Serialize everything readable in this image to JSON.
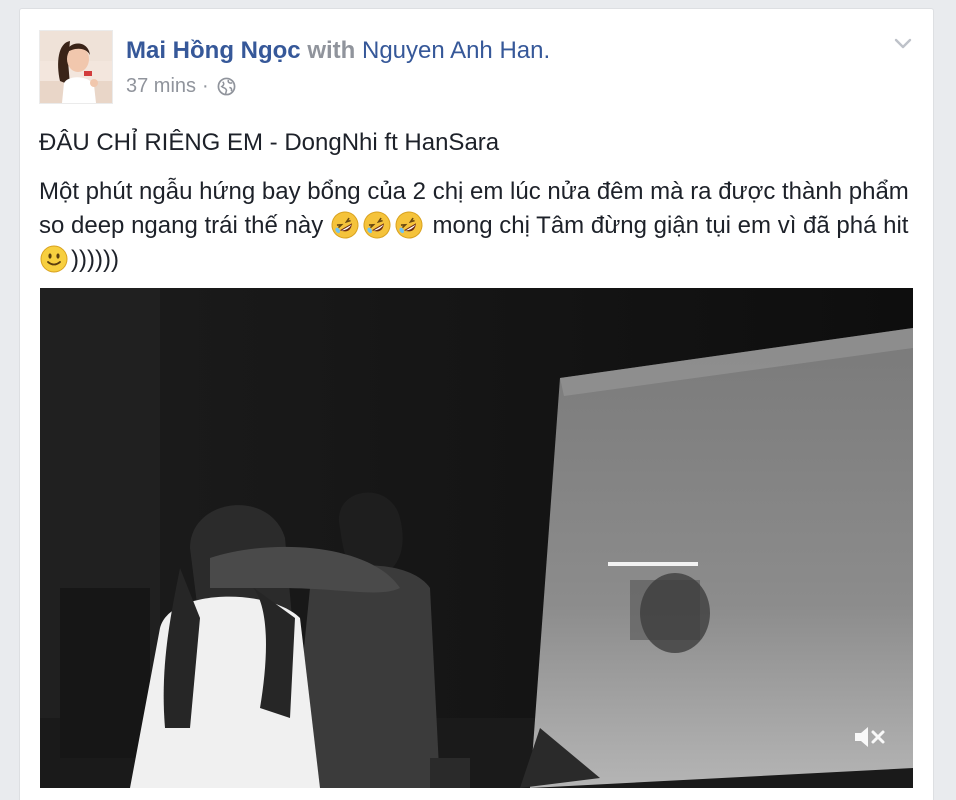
{
  "post": {
    "author": "Mai Hồng Ngọc",
    "with_text": "with",
    "tagged": "Nguyen Anh Han.",
    "timestamp": "37 mins",
    "separator": "·",
    "privacy_icon": "globe-icon",
    "menu_icon": "chevron-down-icon",
    "title": "ĐÂU CHỈ RIÊNG EM - DongNhi ft HanSara",
    "body_part1": "Một phút ngẫu hứng bay bổng của 2 chị em lúc nửa đêm mà ra được thành phẩm so deep ngang trái thế này ",
    "body_part2": " mong chị Tâm đừng giận tụi em vì đã phá hit ",
    "body_part3": "))))))",
    "emojis": [
      "rolling-on-floor-laughing-emoji",
      "rolling-on-floor-laughing-emoji",
      "rolling-on-floor-laughing-emoji",
      "smile-emoji"
    ]
  },
  "video": {
    "muted": true,
    "mute_icon": "speaker-muted-icon"
  },
  "colors": {
    "link": "#365899",
    "meta": "#90949c",
    "text": "#1d2129",
    "background": "#e9ebee"
  }
}
